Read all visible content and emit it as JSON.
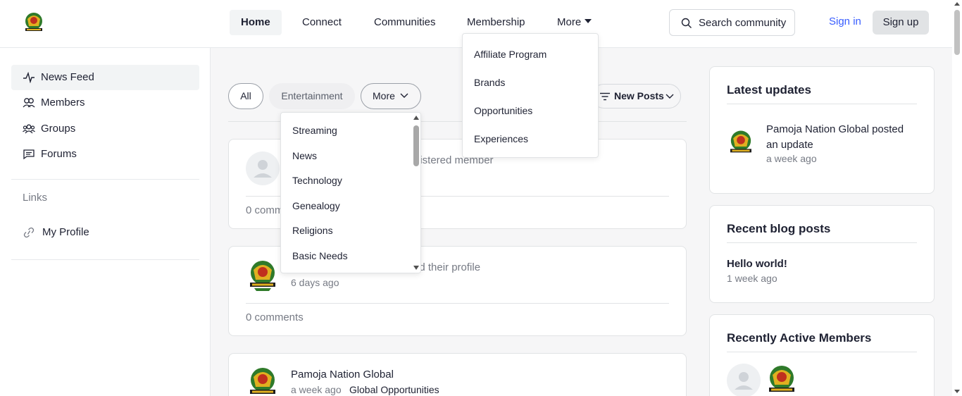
{
  "header": {
    "logo_text": "PAMOJA NATION GLOBAL",
    "nav": [
      {
        "label": "Home",
        "active": true
      },
      {
        "label": "Connect"
      },
      {
        "label": "Communities"
      },
      {
        "label": "Membership"
      },
      {
        "label": "More"
      }
    ],
    "search_label": "Search community",
    "signin_label": "Sign in",
    "signup_label": "Sign up"
  },
  "more_menu": {
    "items": [
      "Affiliate Program",
      "Brands",
      "Opportunities",
      "Experiences"
    ]
  },
  "sidebar": {
    "items": [
      {
        "label": "News Feed",
        "icon": "activity-icon",
        "active": true
      },
      {
        "label": "Members",
        "icon": "members-icon"
      },
      {
        "label": "Groups",
        "icon": "groups-icon"
      },
      {
        "label": "Forums",
        "icon": "forums-icon"
      }
    ],
    "links_heading": "Links",
    "links": [
      {
        "label": "My Profile",
        "icon": "link-icon"
      }
    ]
  },
  "filters": {
    "tabs": [
      "All",
      "Entertainment"
    ],
    "more_label": "More",
    "sort_label": "New Posts",
    "more_options": [
      "Streaming",
      "News",
      "Technology",
      "Genealogy",
      "Religions",
      "Basic Needs"
    ]
  },
  "feed": {
    "posts": [
      {
        "activity": "gistered member",
        "comments": "0 comm"
      },
      {
        "activity": "ed their profile",
        "time": "6 days ago",
        "comments": "0 comments"
      },
      {
        "author": "Pamoja Nation Global",
        "time": "a week ago",
        "group": "Global Opportunities"
      }
    ]
  },
  "widgets": {
    "latest_updates": {
      "title": "Latest updates",
      "text": "Pamoja Nation Global posted an update",
      "time": "a week ago"
    },
    "recent_blog": {
      "title": "Recent blog posts",
      "post_title": "Hello world!",
      "post_time": "1 week ago"
    },
    "active_members": {
      "title": "Recently Active Members"
    }
  },
  "colors": {
    "accent": "#385dff",
    "text": "#1e2132",
    "muted": "#767a84",
    "border": "#e1e3e5"
  }
}
